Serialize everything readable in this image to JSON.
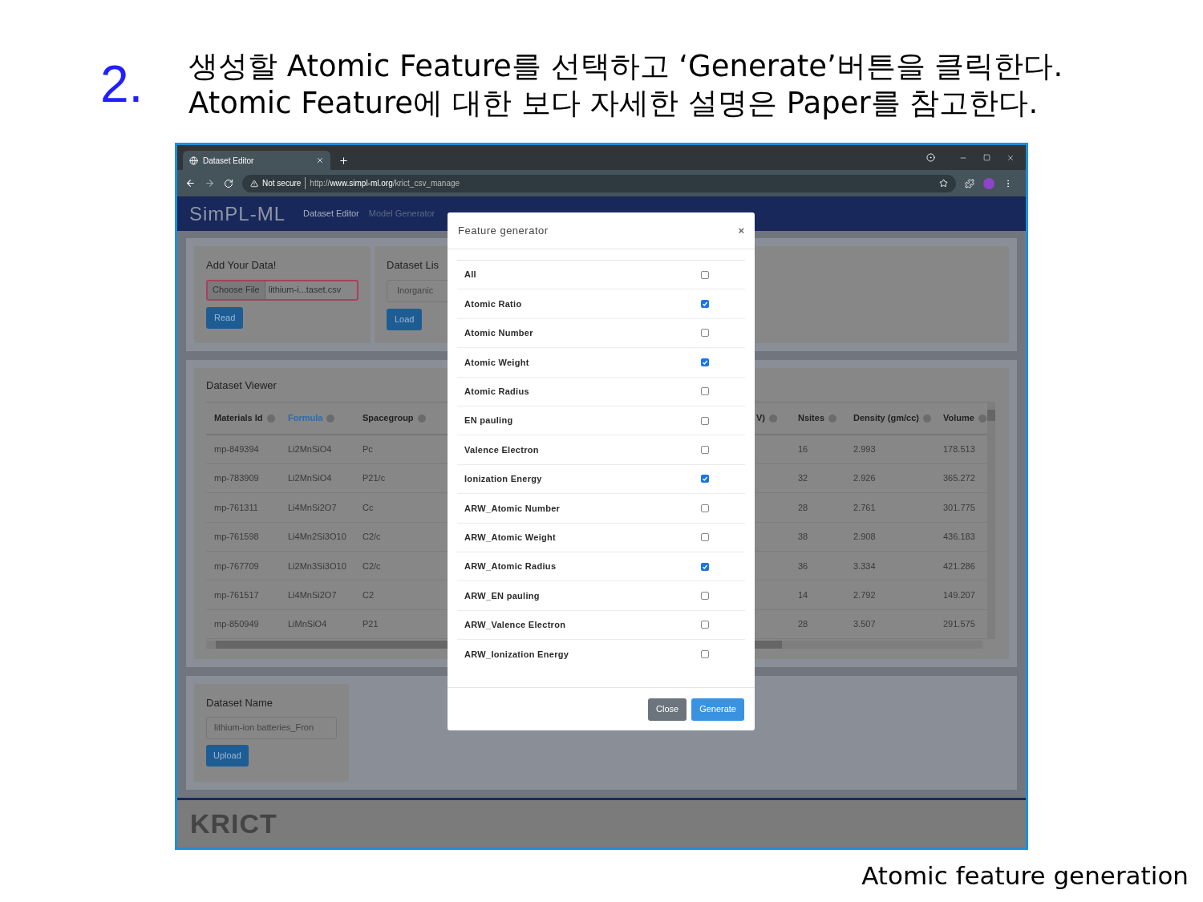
{
  "slide": {
    "step": "2.",
    "lines": [
      "생성할 Atomic Feature를 선택하고 ‘Generate’버튼을 클릭한다.",
      "Atomic Feature에 대한 보다 자세한 설명은 Paper를 참고한다."
    ],
    "caption": "Atomic feature generation"
  },
  "browser": {
    "tab_title": "Dataset Editor",
    "security": "Not secure",
    "url_scheme": "http://",
    "url_host": "www.simpl-ml.org",
    "url_path": "/krict_csv_manage"
  },
  "navbar": {
    "logo": "SimPL-ML",
    "items": [
      {
        "label": "Dataset Editor",
        "selected": true
      },
      {
        "label": "Model Generator",
        "selected": false
      }
    ]
  },
  "add_data": {
    "title": "Add Your Data!",
    "choose_button": "Choose File",
    "file_name": "lithium-i...taset.csv",
    "button": "Read"
  },
  "dataset_list": {
    "title": "Dataset Lis",
    "select": "Inorganic",
    "button": "Load"
  },
  "viewer": {
    "title": "Dataset Viewer",
    "columns": [
      {
        "label": "Materials Id",
        "selected": false
      },
      {
        "label": "Formula",
        "selected": true
      },
      {
        "label": "Spacegroup",
        "selected": false
      },
      {
        "label": "V)",
        "selected": false
      },
      {
        "label": "Nsites",
        "selected": false
      },
      {
        "label": "Density (gm/cc)",
        "selected": false
      },
      {
        "label": "Volume",
        "selected": false
      }
    ],
    "rows": [
      {
        "cells": [
          "mp-849394",
          "Li2MnSiO4",
          "Pc",
          "",
          "16",
          "2.993",
          "178.513"
        ]
      },
      {
        "cells": [
          "mp-783909",
          "Li2MnSiO4",
          "P21/c",
          "",
          "32",
          "2.926",
          "365.272"
        ]
      },
      {
        "cells": [
          "mp-761311",
          "Li4MnSi2O7",
          "Cc",
          "",
          "28",
          "2.761",
          "301.775"
        ]
      },
      {
        "cells": [
          "mp-761598",
          "Li4Mn2Si3O10",
          "C2/c",
          "",
          "38",
          "2.908",
          "436.183"
        ]
      },
      {
        "cells": [
          "mp-767709",
          "Li2Mn3Si3O10",
          "C2/c",
          "",
          "36",
          "3.334",
          "421.286"
        ]
      },
      {
        "cells": [
          "mp-761517",
          "Li4MnSi2O7",
          "C2",
          "",
          "14",
          "2.792",
          "149.207"
        ]
      },
      {
        "cells": [
          "mp-850949",
          "LiMnSiO4",
          "P21",
          "",
          "28",
          "3.507",
          "291.575"
        ]
      }
    ]
  },
  "dataset_name": {
    "title": "Dataset Name",
    "value": "lithium-ion batteries_Fron",
    "button": "Upload"
  },
  "footer": {
    "logo": "KRICT"
  },
  "modal": {
    "title": "Feature generator",
    "close": "×",
    "features": [
      {
        "label": "All",
        "checked": false
      },
      {
        "label": "Atomic Ratio",
        "checked": true
      },
      {
        "label": "Atomic Number",
        "checked": false
      },
      {
        "label": "Atomic Weight",
        "checked": true
      },
      {
        "label": "Atomic Radius",
        "checked": false
      },
      {
        "label": "EN pauling",
        "checked": false
      },
      {
        "label": "Valence Electron",
        "checked": false
      },
      {
        "label": "Ionization Energy",
        "checked": true
      },
      {
        "label": "ARW_Atomic Number",
        "checked": false
      },
      {
        "label": "ARW_Atomic Weight",
        "checked": false
      },
      {
        "label": "ARW_Atomic Radius",
        "checked": true
      },
      {
        "label": "ARW_EN pauling",
        "checked": false
      },
      {
        "label": "ARW_Valence Electron",
        "checked": false
      },
      {
        "label": "ARW_Ionization Energy",
        "checked": false
      }
    ],
    "buttons": [
      {
        "label": "Close",
        "kind": "secondary"
      },
      {
        "label": "Generate",
        "kind": "primary"
      }
    ]
  }
}
